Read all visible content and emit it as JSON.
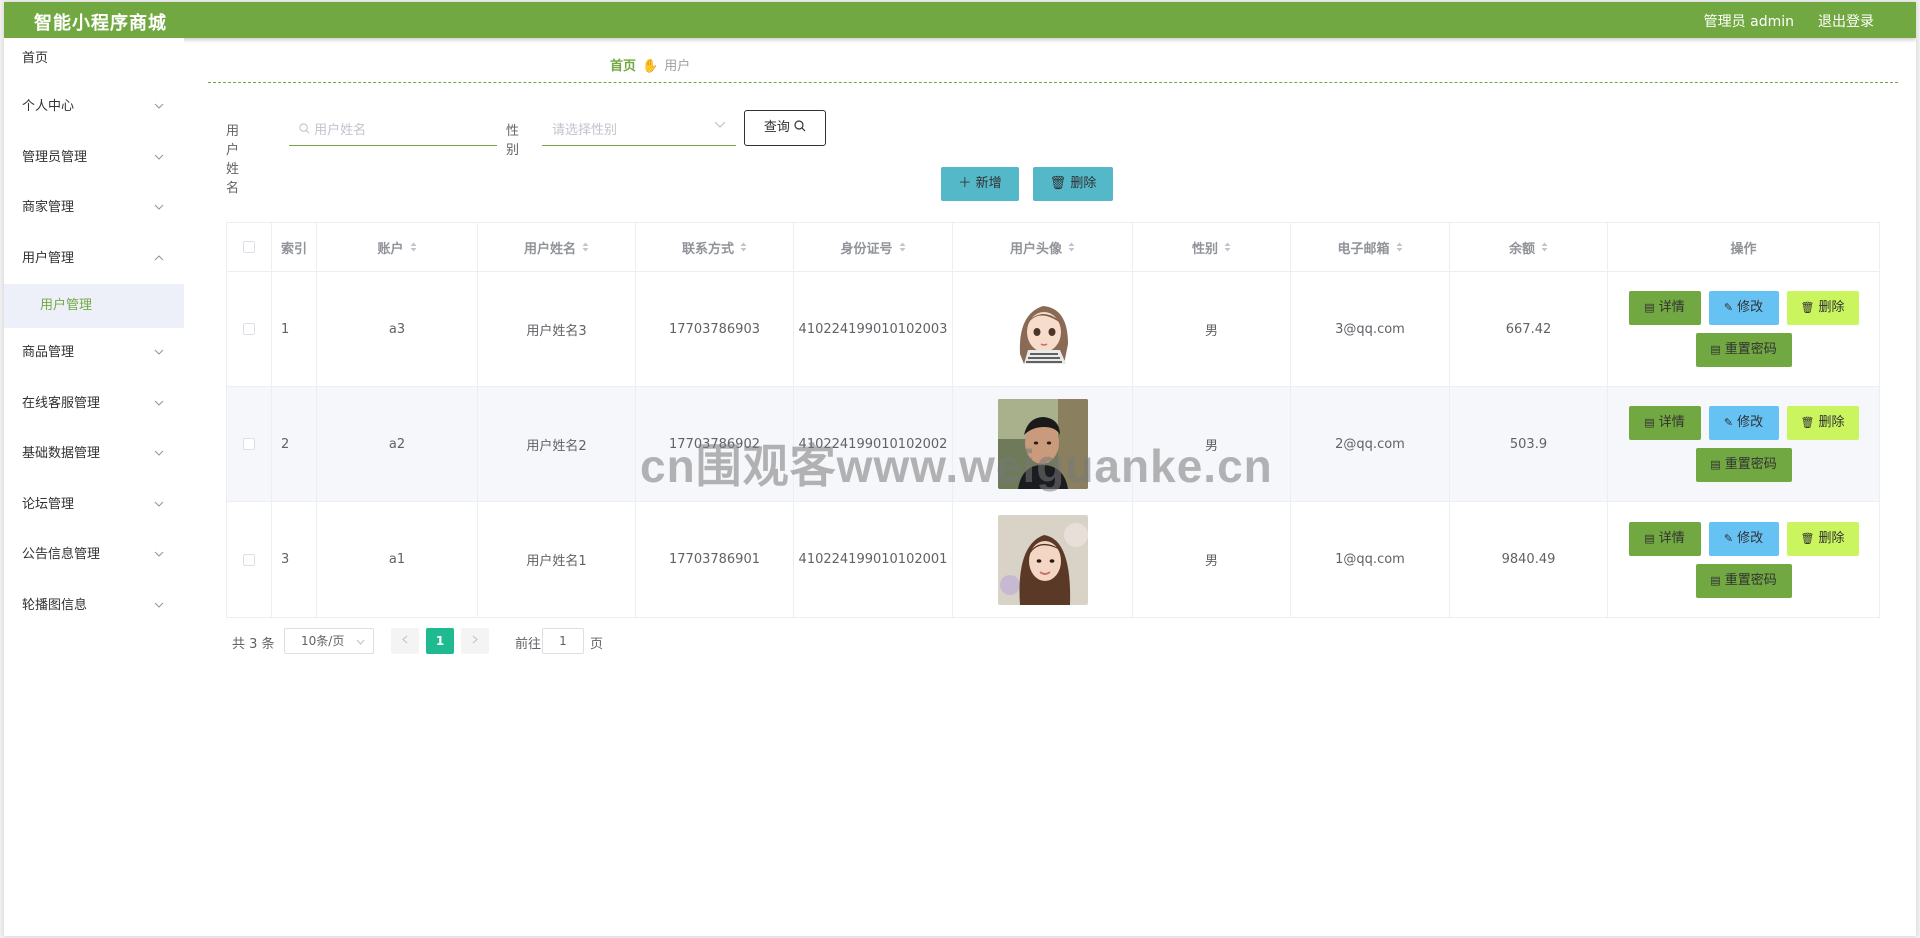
{
  "header": {
    "title": "智能小程序商城",
    "admin": "管理员 admin",
    "logout": "退出登录"
  },
  "sidebar": {
    "items": [
      {
        "label": "首页",
        "expandable": false
      },
      {
        "label": "个人中心",
        "expandable": true
      },
      {
        "label": "管理员管理",
        "expandable": true
      },
      {
        "label": "商家管理",
        "expandable": true
      },
      {
        "label": "用户管理",
        "expandable": true,
        "open": true
      },
      {
        "label": "商品管理",
        "expandable": true
      },
      {
        "label": "在线客服管理",
        "expandable": true
      },
      {
        "label": "基础数据管理",
        "expandable": true
      },
      {
        "label": "论坛管理",
        "expandable": true
      },
      {
        "label": "公告信息管理",
        "expandable": true
      },
      {
        "label": "轮播图信息",
        "expandable": true
      }
    ],
    "sub_item": "用户管理"
  },
  "breadcrumb": {
    "home": "首页",
    "current": "用户"
  },
  "search": {
    "name_label": "用户姓名",
    "name_placeholder": "用户姓名",
    "gender_label": "性别",
    "gender_placeholder": "请选择性别",
    "query_button": "查询"
  },
  "actions": {
    "add": "新增",
    "delete": "删除"
  },
  "table": {
    "columns": [
      "索引",
      "账户",
      "用户姓名",
      "联系方式",
      "身份证号",
      "用户头像",
      "性别",
      "电子邮箱",
      "余额",
      "操作"
    ],
    "rows": [
      {
        "index": "1",
        "account": "a3",
        "name": "用户姓名3",
        "phone": "17703786903",
        "id_no": "410224199010102003",
        "gender": "男",
        "email": "3@qq.com",
        "balance": "667.42",
        "avatar": "cartoon-girl-avatar"
      },
      {
        "index": "2",
        "account": "a2",
        "name": "用户姓名2",
        "phone": "17703786902",
        "id_no": "410224199010102002",
        "gender": "男",
        "email": "2@qq.com",
        "balance": "503.9",
        "avatar": "man-photo-avatar"
      },
      {
        "index": "3",
        "account": "a1",
        "name": "用户姓名1",
        "phone": "17703786901",
        "id_no": "410224199010102001",
        "gender": "男",
        "email": "1@qq.com",
        "balance": "9840.49",
        "avatar": "woman-photo-avatar"
      }
    ],
    "op_labels": {
      "detail": "详情",
      "edit": "修改",
      "delete": "删除",
      "reset_password": "重置密码"
    }
  },
  "pagination": {
    "total": "共 3 条",
    "page_size": "10条/页",
    "current_page": "1",
    "goto_label": "前往",
    "goto_value": "1",
    "unit": "页"
  },
  "watermark": "cn围观客www.weiguanke.cn",
  "colors": {
    "primary": "#72a841",
    "info": "#55b8c9",
    "edit": "#67c2f4",
    "danger_light": "#caf55e",
    "pager_active": "#1fba8f"
  }
}
